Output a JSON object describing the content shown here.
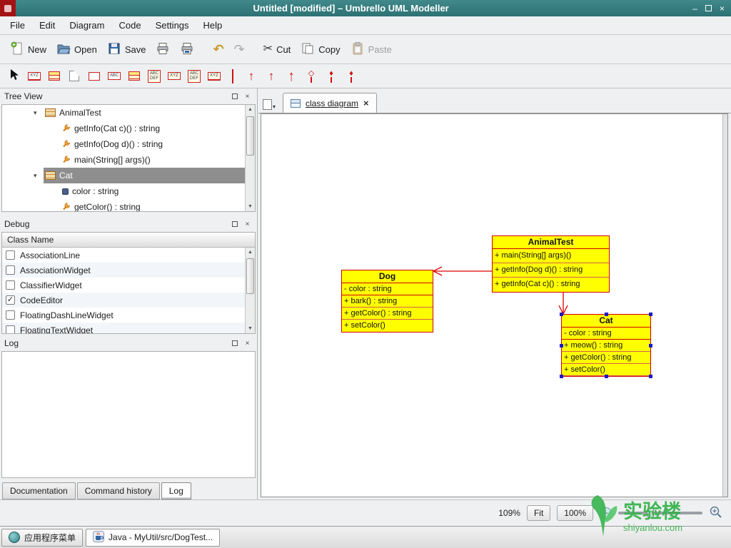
{
  "window": {
    "title": "Untitled [modified] – Umbrello UML Modeller"
  },
  "icons": {
    "minimize": "–",
    "close": "×",
    "expander_open": "▾",
    "dropdown_arrow": "▾",
    "undo": "↶",
    "redo": "↷",
    "cut": "✂",
    "check": "✓",
    "zoom_out": "−",
    "arrow_up": "↑",
    "diamond_filled": "♦",
    "diamond_hollow": "◇",
    "scroll_up": "▲",
    "scroll_down": "▼"
  },
  "menubar": {
    "items": [
      "File",
      "Edit",
      "Diagram",
      "Code",
      "Settings",
      "Help"
    ]
  },
  "toolbar": {
    "new": "New",
    "open": "Open",
    "save": "Save",
    "cut": "Cut",
    "copy": "Copy",
    "paste": "Paste"
  },
  "uml_toolbar": {
    "labels": {
      "xyz": "XYZ",
      "abc": "ABC",
      "def": "DEF"
    }
  },
  "tree_view": {
    "title": "Tree View",
    "items": [
      {
        "label": "AnimalTest",
        "type": "class"
      },
      {
        "label": "getInfo(Cat c)() : string",
        "type": "method"
      },
      {
        "label": "getInfo(Dog d)() : string",
        "type": "method"
      },
      {
        "label": "main(String[] args)()",
        "type": "method"
      },
      {
        "label": "Cat",
        "type": "class",
        "selected": true
      },
      {
        "label": "color : string",
        "type": "attribute"
      },
      {
        "label": "getColor() : string",
        "type": "method"
      }
    ]
  },
  "debug": {
    "title": "Debug",
    "column_header": "Class Name",
    "items": [
      {
        "label": "AssociationLine",
        "checked": false
      },
      {
        "label": "AssociationWidget",
        "checked": false
      },
      {
        "label": "ClassifierWidget",
        "checked": false
      },
      {
        "label": "CodeEditor",
        "checked": true
      },
      {
        "label": "FloatingDashLineWidget",
        "checked": false
      },
      {
        "label": "FloatingTextWidget",
        "checked": false
      }
    ]
  },
  "log": {
    "title": "Log"
  },
  "bottom_tabs": {
    "items": [
      "Documentation",
      "Command history",
      "Log"
    ],
    "active": "Log"
  },
  "diagram": {
    "tab_label": "class diagram",
    "classes": [
      {
        "name": "AnimalTest",
        "attributes": [],
        "methods": [
          "+ main(String[] args)()",
          "+ getInfo(Dog d)() : string",
          "+ getInfo(Cat c)() : string"
        ]
      },
      {
        "name": "Dog",
        "attributes": [
          "- color : string"
        ],
        "methods": [
          "+ bark() : string",
          "+ getColor() : string",
          "+ setColor()"
        ]
      },
      {
        "name": "Cat",
        "attributes": [
          "- color : string"
        ],
        "methods": [
          "+ meow() : string",
          "+ getColor() : string",
          "+ setColor()"
        ]
      }
    ],
    "colors": {
      "box_fill": "#ffff00",
      "box_border": "#cf0000",
      "line": "#e00000",
      "selection": "#1a1acc"
    }
  },
  "statusbar": {
    "zoom_percent": "109%",
    "fit_label": "Fit",
    "zoom_value": "100%"
  },
  "taskbar": {
    "app_menu_label": "应用程序菜单",
    "task_label": "Java - MyUtil/src/DogTest..."
  },
  "watermark": {
    "title": "实验楼",
    "subtitle": "shiyanlou.com"
  }
}
